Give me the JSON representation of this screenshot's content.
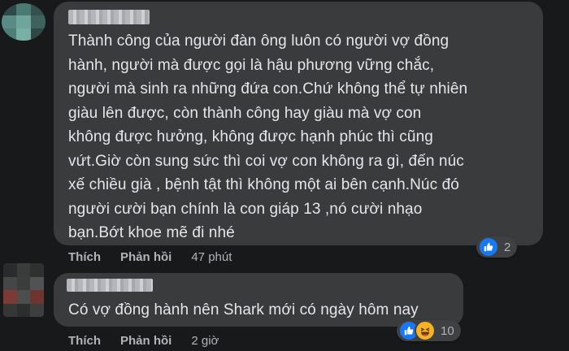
{
  "comments": [
    {
      "author": "",
      "text": "Thành công của người đàn ông luôn có người vợ đồng\nhành, người mà được gọi là hậu phương vững chắc,\nngười mà sinh ra những đứa con.Chứ không thể tự nhiên\ngiàu lên được, còn thành công hay giàu mà vợ con\nkhông được hưởng, không được hạnh phúc thì cũng\nvứt.Giờ còn sung sức thì coi vợ con không ra gì, đến núc\nxế chiều già , bệnh tật thì không một ai bên cạnh.Núc đó\nngười cười bạn chính là con giáp 13 ,nó cười nhạo\nbạn.Bớt khoe mẽ đi nhé",
      "like_label": "Thích",
      "reply_label": "Phản hồi",
      "time": "47 phút",
      "reactions": [
        "like-icon"
      ],
      "reaction_count": "2"
    },
    {
      "author": "",
      "text": "Có vợ đồng hành nên Shark mới có ngày hôm nay",
      "like_label": "Thích",
      "reply_label": "Phản hồi",
      "time": "2 giờ",
      "reactions": [
        "like-icon",
        "haha-icon"
      ],
      "reaction_count": "10"
    }
  ],
  "colors": {
    "background": "#18191a",
    "bubble": "#3a3b3c",
    "text": "#e4e6eb",
    "secondary_text": "#b0b3b8",
    "like_blue": "#1877f2",
    "haha_yellow": "#f7b125"
  }
}
